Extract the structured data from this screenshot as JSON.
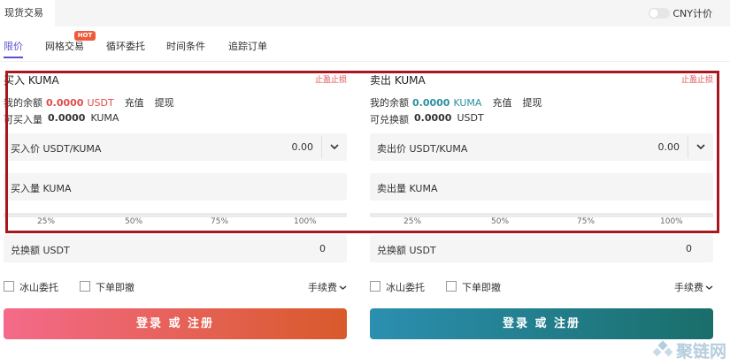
{
  "top_tab": "现货交易",
  "cny_toggle_label": "CNY计价",
  "order_tabs": [
    {
      "label": "限价"
    },
    {
      "label": "网格交易"
    },
    {
      "label": "循环委托"
    },
    {
      "label": "时间条件"
    },
    {
      "label": "追踪订单"
    }
  ],
  "hot_badge": "HOT",
  "buy": {
    "title": "买入 KUMA",
    "stop_loss": "止盈止损",
    "balance_label": "我的余额",
    "balance_value": "0.0000",
    "balance_unit": "USDT",
    "deposit": "充值",
    "withdraw": "提现",
    "avail_label": "可买入量",
    "avail_value": "0.0000",
    "avail_unit": "KUMA",
    "price_label": "买入价 USDT/KUMA",
    "price_value": "0.00",
    "amount_label": "买入量 KUMA",
    "pcts": [
      "25%",
      "50%",
      "75%",
      "100%"
    ],
    "total_label": "兑换额 USDT",
    "total_value": "0",
    "iceberg": "冰山委托",
    "ioc": "下单即撤",
    "fee": "手续费",
    "button": "登录 或 注册"
  },
  "sell": {
    "title": "卖出 KUMA",
    "stop_loss": "止盈止损",
    "balance_label": "我的余额",
    "balance_value": "0.0000",
    "balance_unit": "KUMA",
    "deposit": "充值",
    "withdraw": "提现",
    "avail_label": "可兑换额",
    "avail_value": "0.0000",
    "avail_unit": "USDT",
    "price_label": "卖出价 USDT/KUMA",
    "price_value": "0.00",
    "amount_label": "卖出量 KUMA",
    "pcts": [
      "25%",
      "50%",
      "75%",
      "100%"
    ],
    "total_label": "兑换额 USDT",
    "total_value": "0",
    "iceberg": "冰山委托",
    "ioc": "下单即撤",
    "fee": "手续费",
    "button": "登录 或 注册"
  },
  "watermark_text": "聚链网",
  "colors": {
    "accent": "#5a4fd0",
    "buy_red": "#e04c4c",
    "sell_teal": "#2a8fa0",
    "highlight_box": "#a8171e"
  }
}
